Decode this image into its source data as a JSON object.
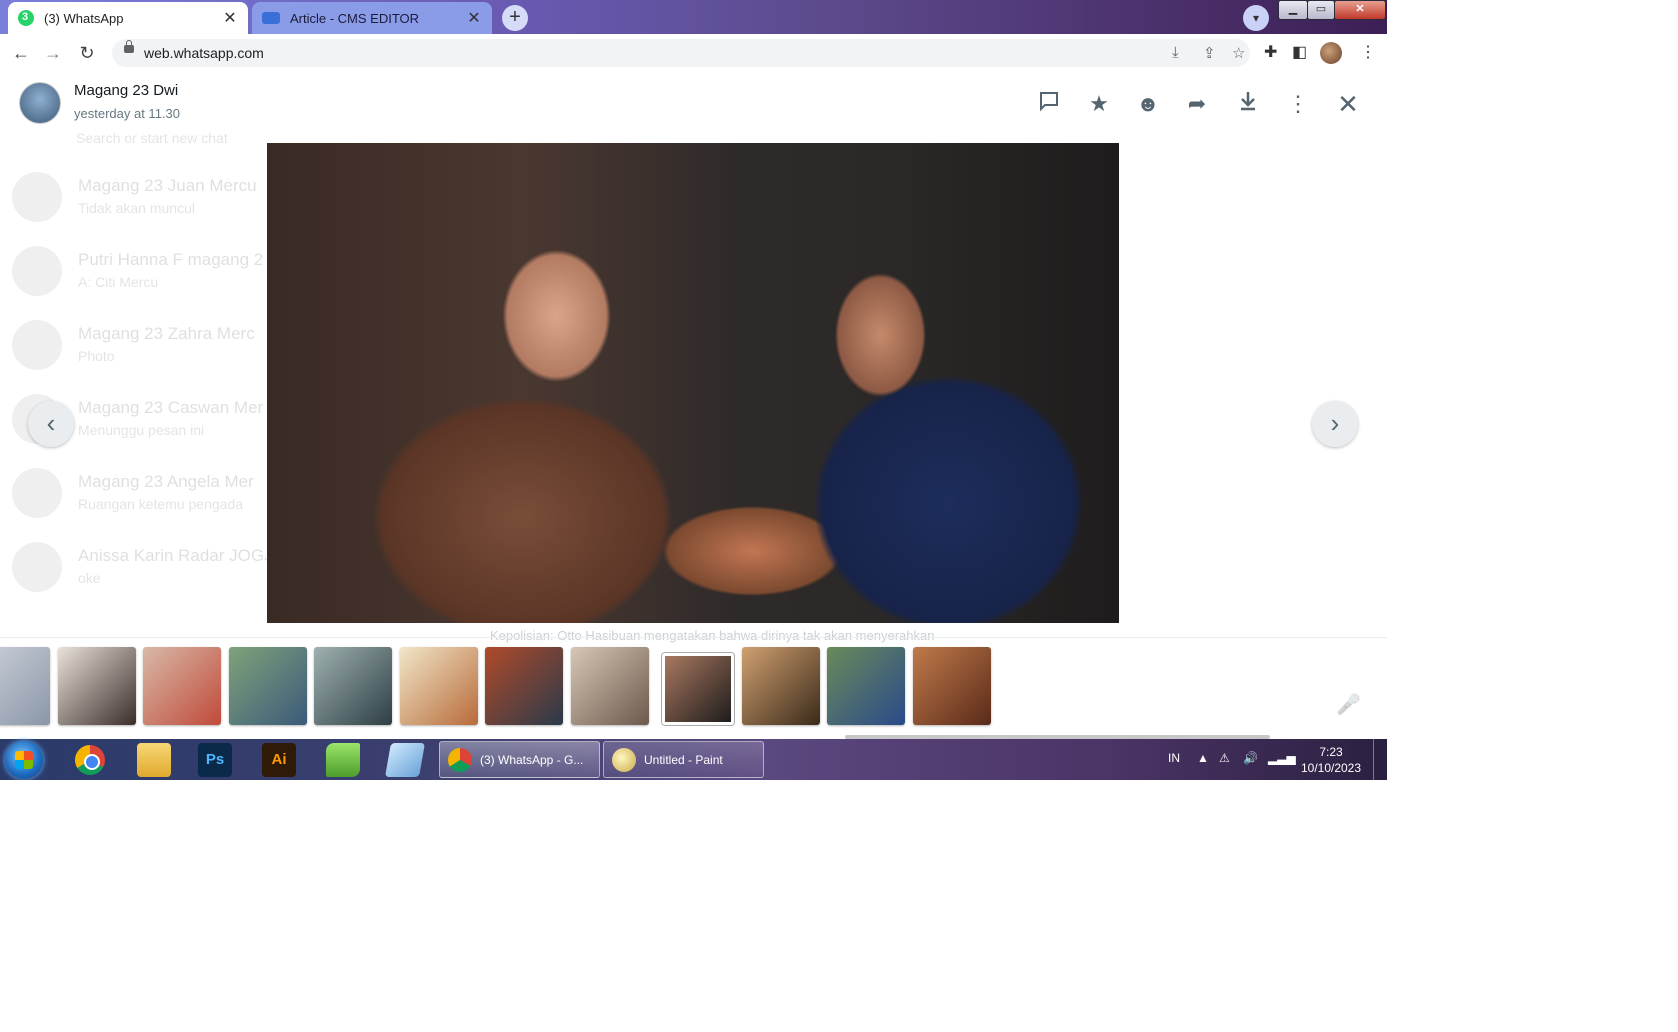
{
  "browser": {
    "tabs": [
      {
        "label": "(3) WhatsApp",
        "active": true
      },
      {
        "label": "Article - CMS EDITOR",
        "active": false
      }
    ],
    "close_glyph": "✕",
    "new_tab_glyph": "+",
    "url": "web.whatsapp.com"
  },
  "viewer": {
    "sender_name": "Magang 23 Dwi",
    "timestamp": "yesterday at 11.30",
    "icons": [
      "reply-icon",
      "star-icon",
      "emoji-icon",
      "forward-icon",
      "download-icon",
      "menu-icon",
      "close-icon"
    ],
    "caption": "Kepolisian: Otto Hasibuan mengatakan bahwa dirinya tak akan menyerahkan"
  },
  "background_chats": {
    "search_placeholder": "Search or start new chat",
    "items": [
      {
        "name": "Magang 23 Juan Mercu",
        "sub": "Tidak akan muncul"
      },
      {
        "name": "Putri Hanna F magang 2",
        "sub": "A: Citi Mercu"
      },
      {
        "name": "Magang 23 Zahra Merc",
        "sub": "Photo"
      },
      {
        "name": "Magang 23 Caswan Mer",
        "sub": "Menunggu pesan ini"
      },
      {
        "name": "Magang 23 Angela Mer",
        "sub": "Ruangan ketemu pengada"
      },
      {
        "name": "Anissa Karin Radar JOGJ",
        "sub": "oke"
      }
    ]
  },
  "thumbnails": [
    {
      "name": "thumb-1",
      "colors": [
        "#cfd4dc",
        "#8a96a8"
      ]
    },
    {
      "name": "thumb-2",
      "colors": [
        "#e9e2da",
        "#3b2e2a"
      ]
    },
    {
      "name": "thumb-3",
      "colors": [
        "#d9b9a8",
        "#c04a3a"
      ]
    },
    {
      "name": "thumb-4",
      "colors": [
        "#7fa37a",
        "#3b5a7a"
      ]
    },
    {
      "name": "thumb-5",
      "colors": [
        "#9fb0b0",
        "#2e3f45"
      ]
    },
    {
      "name": "thumb-6",
      "colors": [
        "#f1e6c8",
        "#b86b3a"
      ]
    },
    {
      "name": "thumb-7",
      "colors": [
        "#b04a2a",
        "#2a3a4a"
      ]
    },
    {
      "name": "thumb-8",
      "colors": [
        "#d8c6b5",
        "#6b5a4d"
      ]
    },
    {
      "name": "thumb-9-selected",
      "colors": [
        "#a87860",
        "#1e1c1c"
      ]
    },
    {
      "name": "thumb-10",
      "colors": [
        "#d0a070",
        "#3a2a1a"
      ]
    },
    {
      "name": "thumb-11",
      "colors": [
        "#6a8a5a",
        "#2a4a8a"
      ]
    },
    {
      "name": "thumb-12",
      "colors": [
        "#c07a4a",
        "#5a2a1a"
      ]
    }
  ],
  "taskbar": {
    "apps": [
      {
        "name": "chrome"
      },
      {
        "name": "file-explorer"
      },
      {
        "name": "photoshop",
        "label": "Ps"
      },
      {
        "name": "illustrator",
        "label": "Ai"
      },
      {
        "name": "notepad-plus"
      },
      {
        "name": "notepad"
      }
    ],
    "tasks": [
      {
        "label": "(3) WhatsApp - G..."
      },
      {
        "label": "Untitled - Paint"
      }
    ],
    "language": "IN",
    "time": "7:23",
    "date": "10/10/2023"
  },
  "colors": {
    "tab_strip": "#6a5bb5",
    "viewer_bg": "#ffffff",
    "icon": "#54656f",
    "taskbar": "#3b3f6e"
  }
}
